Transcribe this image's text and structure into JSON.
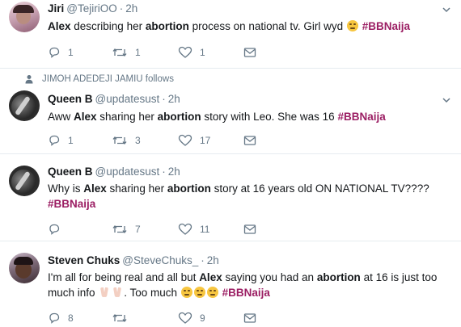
{
  "tweets": [
    {
      "name": "Jiri",
      "handle": "@TejiriOO",
      "separator": "·",
      "time": "2h",
      "text": {
        "kw1": "Alex",
        "t1": " describing her ",
        "kw2": "abortion",
        "t2": " process on national tv. Girl wyd ",
        "tag": "#BBNaija"
      },
      "emoji": [
        "weary-face"
      ],
      "replies": "1",
      "retweets": "1",
      "likes": "1"
    },
    {
      "follows_note": "JIMOH ADEDEJI JAMIU follows",
      "name": "Queen B",
      "handle": "@updatesust",
      "separator": "·",
      "time": "2h",
      "text": {
        "t0": "Aww ",
        "kw1": "Alex",
        "t1": " sharing her ",
        "kw2": "abortion",
        "t2": " story with Leo. She was 16  ",
        "tag": "#BBNaija"
      },
      "replies": "1",
      "retweets": "3",
      "likes": "17"
    },
    {
      "name": "Queen B",
      "handle": "@updatesust",
      "separator": "·",
      "time": "2h",
      "text": {
        "t0": "Why is ",
        "kw1": "Alex",
        "t1": " sharing her ",
        "kw2": "abortion",
        "t2": " story at 16 years old ON NATIONAL TV????",
        "tag": "#BBNaija"
      },
      "replies": "",
      "retweets": "7",
      "likes": "11"
    },
    {
      "name": "Steven Chuks",
      "handle": "@SteveChuks_",
      "separator": "·",
      "time": "2h",
      "text": {
        "t0": "I'm all for being real and all but ",
        "kw1": "Alex",
        "t1": " saying you had an ",
        "kw2": "abortion",
        "t2": " at 16 is just too",
        "t3": "much info ",
        "t4": ". Too much ",
        "tag": "#BBNaija"
      },
      "emoji": [
        "folded-hands",
        "folded-hands",
        "weary-face",
        "weary-face",
        "weary-face"
      ],
      "replies": "8",
      "retweets": "",
      "likes": "9"
    }
  ],
  "colors": {
    "hashtag": "#9b1e63",
    "secondary_text": "#657786",
    "divider": "#e6ecf0"
  }
}
